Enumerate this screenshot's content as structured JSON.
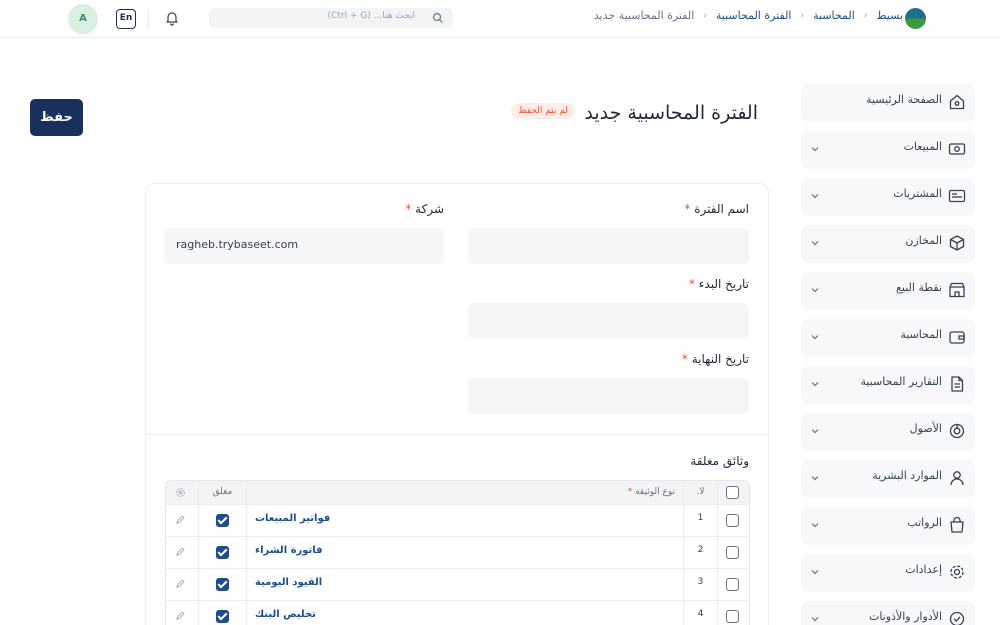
{
  "header": {
    "breadcrumbs": [
      "بسيط",
      "المحاسبة",
      "الفترة المحاسبية",
      "الفترة المحاسبية جديد"
    ],
    "search_placeholder": "ابحث هنا... (Ctrl + G)",
    "lang_label": "En",
    "avatar_initial": "A"
  },
  "sidebar": {
    "items": [
      {
        "label": "الصفحة الرئيسية",
        "icon": "home-icon",
        "has_chevron": false
      },
      {
        "label": "المبيعات",
        "icon": "cash-icon",
        "has_chevron": true
      },
      {
        "label": "المشتريات",
        "icon": "purchases-icon",
        "has_chevron": true
      },
      {
        "label": "المخازن",
        "icon": "box-icon",
        "has_chevron": true
      },
      {
        "label": "نقطة البيع",
        "icon": "store-icon",
        "has_chevron": true
      },
      {
        "label": "المحاسبة",
        "icon": "wallet-icon",
        "has_chevron": true
      },
      {
        "label": "التقارير المحاسبية",
        "icon": "report-icon",
        "has_chevron": true
      },
      {
        "label": "الأصول",
        "icon": "pie-icon",
        "has_chevron": true
      },
      {
        "label": "الموارد البشرية",
        "icon": "user-icon",
        "has_chevron": true
      },
      {
        "label": "الرواتب",
        "icon": "bag-icon",
        "has_chevron": true
      },
      {
        "label": "إعدادات",
        "icon": "gear-icon",
        "has_chevron": true
      },
      {
        "label": "الأدوار والأذونات",
        "icon": "shield-check-icon",
        "has_chevron": true
      }
    ]
  },
  "page": {
    "title": "الفترة المحاسبية جديد",
    "status_badge": "لم يتم الحفظ",
    "save_label": "حفظ"
  },
  "form": {
    "period_name_label": "اسم الفترة",
    "company_label": "شركة",
    "company_value": "ragheb.trybaseet.com",
    "start_date_label": "تاريخ البدء",
    "end_date_label": "تاريخ النهاية",
    "required_mark": "*"
  },
  "closed_docs": {
    "title": "وثائق مغلقة",
    "headers": {
      "num": "لا.",
      "doc_type": "نوع الوثيقة",
      "closed": "مغلق"
    },
    "rows": [
      {
        "num": "1",
        "doc_type": "فواتير المبيعات",
        "closed": true
      },
      {
        "num": "2",
        "doc_type": "فاتورة الشراء",
        "closed": true
      },
      {
        "num": "3",
        "doc_type": "القيود اليومية",
        "closed": true
      },
      {
        "num": "4",
        "doc_type": "تخليص البنك",
        "closed": true
      }
    ]
  },
  "colors": {
    "primary": "#17305c",
    "link": "#1f4e89",
    "badge_text": "#e8562a",
    "badge_bg": "#fdecea"
  }
}
